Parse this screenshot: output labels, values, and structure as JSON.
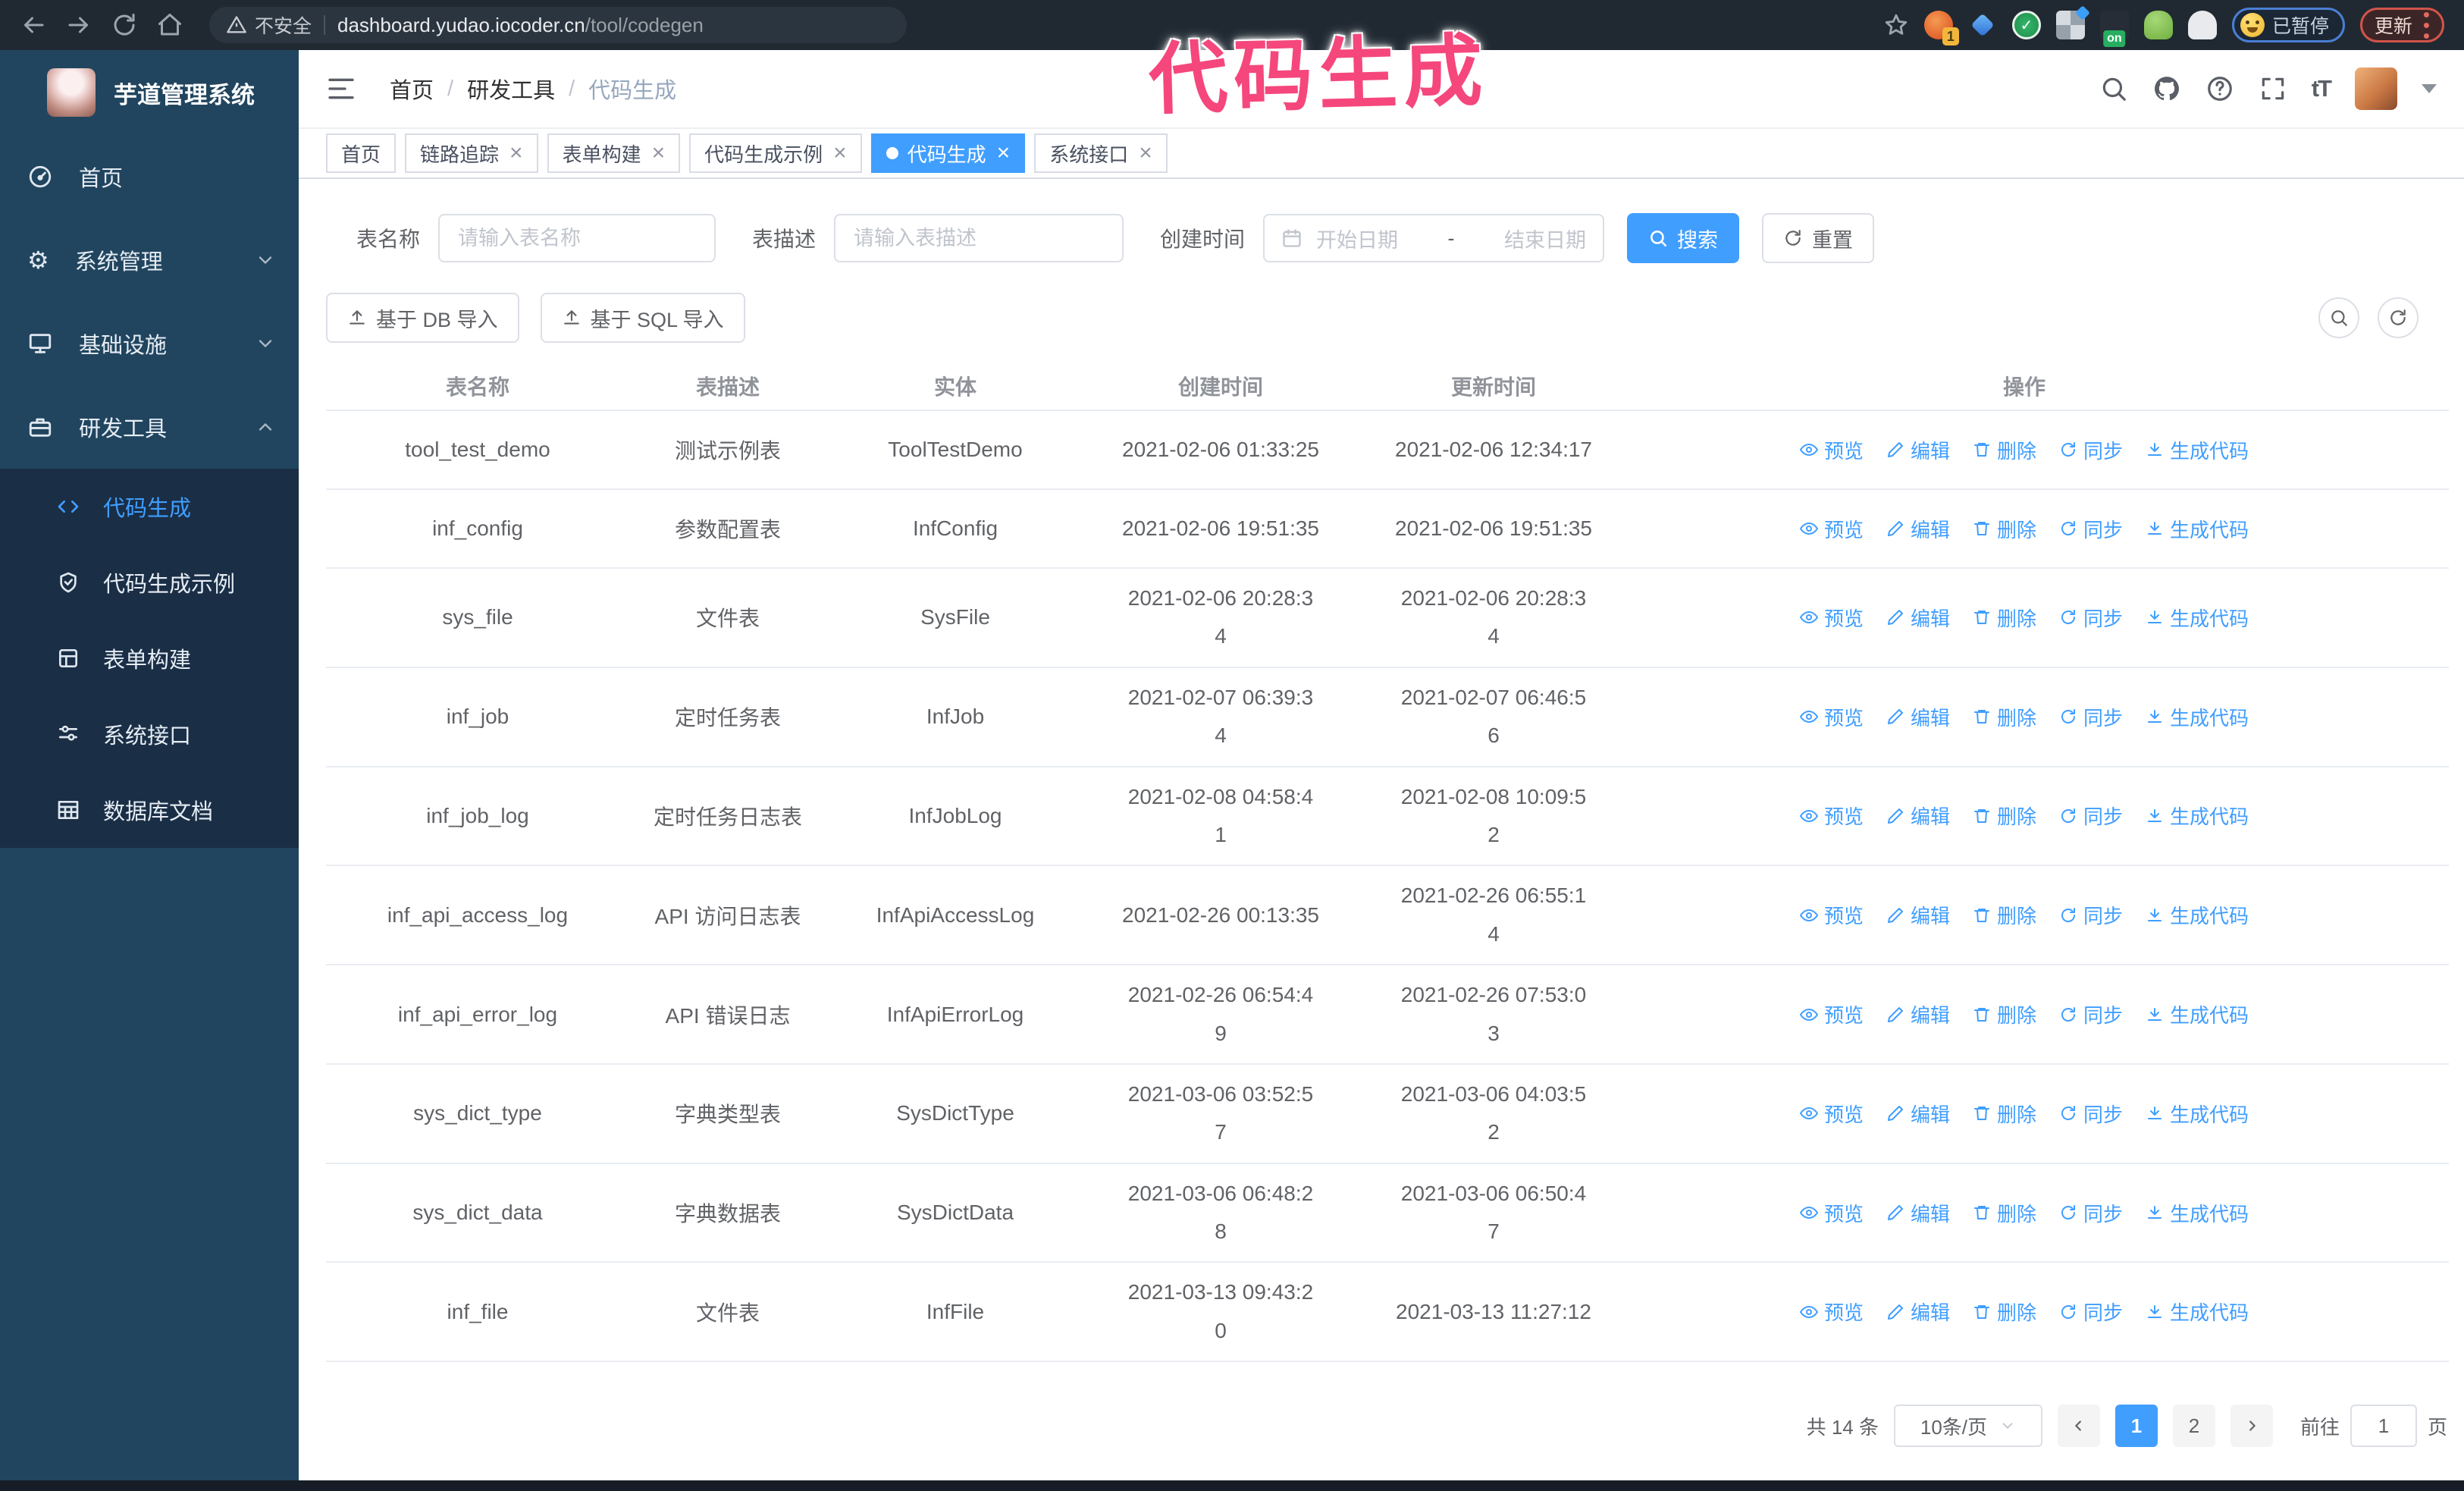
{
  "colors": {
    "accent": "#409eff",
    "annotation_pink": "#f5477c",
    "topbar_bg": "#202932",
    "sidebar_bg": "#21455f",
    "submenu_bg": "#1a2e46"
  },
  "browser": {
    "security_warning": "不安全",
    "url_host": "dashboard.yudao.iocoder.cn",
    "url_path": "/tool/codegen",
    "extension_badge": "1",
    "extension_on_badge": "on",
    "paused_badge": "已暂停",
    "update_button": "更新"
  },
  "annotation": {
    "text": "代码生成"
  },
  "sidebar": {
    "app_title": "芋道管理系统",
    "items": [
      {
        "label": "首页",
        "icon": "home-icon"
      },
      {
        "label": "系统管理",
        "icon": "gear-icon",
        "chevron": "down"
      },
      {
        "label": "基础设施",
        "icon": "monitor-icon",
        "chevron": "down"
      },
      {
        "label": "研发工具",
        "icon": "toolbox-icon",
        "chevron": "up"
      }
    ],
    "submenu": [
      {
        "label": "代码生成",
        "icon": "code-icon",
        "active": true
      },
      {
        "label": "代码生成示例",
        "icon": "shield-check-icon"
      },
      {
        "label": "表单构建",
        "icon": "form-icon"
      },
      {
        "label": "系统接口",
        "icon": "sliders-icon"
      },
      {
        "label": "数据库文档",
        "icon": "database-icon"
      }
    ]
  },
  "header": {
    "breadcrumb": {
      "root": "首页",
      "section": "研发工具",
      "current": "代码生成",
      "separator": "/"
    }
  },
  "tabs": [
    {
      "label": "首页",
      "closable": false,
      "active": false
    },
    {
      "label": "链路追踪",
      "closable": true,
      "active": false
    },
    {
      "label": "表单构建",
      "closable": true,
      "active": false
    },
    {
      "label": "代码生成示例",
      "closable": true,
      "active": false
    },
    {
      "label": "代码生成",
      "closable": true,
      "active": true
    },
    {
      "label": "系统接口",
      "closable": true,
      "active": false
    }
  ],
  "search": {
    "name_label": "表名称",
    "name_placeholder": "请输入表名称",
    "desc_label": "表描述",
    "desc_placeholder": "请输入表描述",
    "time_label": "创建时间",
    "start_placeholder": "开始日期",
    "range_separator": "-",
    "end_placeholder": "结束日期",
    "search_label": "搜索",
    "reset_label": "重置"
  },
  "toolbar": {
    "import_db": "基于 DB 导入",
    "import_sql": "基于 SQL 导入"
  },
  "table": {
    "columns": [
      "表名称",
      "表描述",
      "实体",
      "创建时间",
      "更新时间",
      "操作"
    ],
    "actions": [
      {
        "label": "预览",
        "icon": "eye-icon"
      },
      {
        "label": "编辑",
        "icon": "edit-icon"
      },
      {
        "label": "删除",
        "icon": "delete-icon"
      },
      {
        "label": "同步",
        "icon": "sync-icon"
      },
      {
        "label": "生成代码",
        "icon": "download-icon"
      }
    ],
    "rows": [
      {
        "name": "tool_test_demo",
        "desc": "测试示例表",
        "entity": "ToolTestDemo",
        "created": "2021-02-06 01:33:25",
        "updated": "2021-02-06 12:34:17"
      },
      {
        "name": "inf_config",
        "desc": "参数配置表",
        "entity": "InfConfig",
        "created": "2021-02-06 19:51:35",
        "updated": "2021-02-06 19:51:35"
      },
      {
        "name": "sys_file",
        "desc": "文件表",
        "entity": "SysFile",
        "created": "2021-02-06 20:28:3\n4",
        "updated": "2021-02-06 20:28:3\n4"
      },
      {
        "name": "inf_job",
        "desc": "定时任务表",
        "entity": "InfJob",
        "created": "2021-02-07 06:39:3\n4",
        "updated": "2021-02-07 06:46:5\n6"
      },
      {
        "name": "inf_job_log",
        "desc": "定时任务日志表",
        "entity": "InfJobLog",
        "created": "2021-02-08 04:58:4\n1",
        "updated": "2021-02-08 10:09:5\n2"
      },
      {
        "name": "inf_api_access_log",
        "desc": "API 访问日志表",
        "entity": "InfApiAccessLog",
        "created": "2021-02-26 00:13:35",
        "updated": "2021-02-26 06:55:1\n4"
      },
      {
        "name": "inf_api_error_log",
        "desc": "API 错误日志",
        "entity": "InfApiErrorLog",
        "created": "2021-02-26 06:54:4\n9",
        "updated": "2021-02-26 07:53:0\n3"
      },
      {
        "name": "sys_dict_type",
        "desc": "字典类型表",
        "entity": "SysDictType",
        "created": "2021-03-06 03:52:5\n7",
        "updated": "2021-03-06 04:03:5\n2"
      },
      {
        "name": "sys_dict_data",
        "desc": "字典数据表",
        "entity": "SysDictData",
        "created": "2021-03-06 06:48:2\n8",
        "updated": "2021-03-06 06:50:4\n7"
      },
      {
        "name": "inf_file",
        "desc": "文件表",
        "entity": "InfFile",
        "created": "2021-03-13 09:43:2\n0",
        "updated": "2021-03-13 11:27:12"
      }
    ]
  },
  "pagination": {
    "total": "共 14 条",
    "page_size": "10条/页",
    "pages": [
      "1",
      "2"
    ],
    "active_page": "1",
    "goto_label": "前往",
    "goto_value": "1",
    "goto_suffix": "页"
  }
}
